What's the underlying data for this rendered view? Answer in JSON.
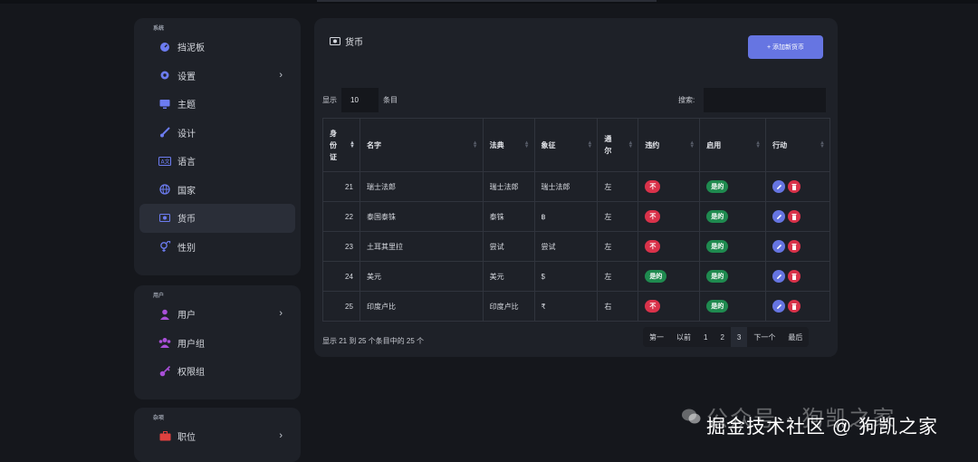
{
  "sidebar": {
    "section_system": "系统",
    "system_items": [
      {
        "label": "挡泥板",
        "icon": "dashboard-icon",
        "chevron": false,
        "active": false
      },
      {
        "label": "设置",
        "icon": "gear-icon",
        "chevron": true,
        "active": false
      },
      {
        "label": "主题",
        "icon": "monitor-icon",
        "chevron": false,
        "active": false
      },
      {
        "label": "设计",
        "icon": "brush-icon",
        "chevron": false,
        "active": false
      },
      {
        "label": "语言",
        "icon": "language-icon",
        "chevron": false,
        "active": false
      },
      {
        "label": "国家",
        "icon": "globe-icon",
        "chevron": false,
        "active": false
      },
      {
        "label": "货币",
        "icon": "money-icon",
        "chevron": false,
        "active": true
      },
      {
        "label": "性别",
        "icon": "gender-icon",
        "chevron": false,
        "active": false
      }
    ],
    "section_users": "用户",
    "user_items": [
      {
        "label": "用户",
        "icon": "user-icon",
        "chevron": true
      },
      {
        "label": "用户组",
        "icon": "users-icon",
        "chevron": false
      },
      {
        "label": "权限组",
        "icon": "key-icon",
        "chevron": false
      }
    ],
    "section_misc": "杂项",
    "misc_items": [
      {
        "label": "职位",
        "icon": "briefcase-icon",
        "chevron": true
      }
    ]
  },
  "main": {
    "title": "货币",
    "add_button": "+ 添加新货币",
    "show_label": "显示",
    "page_length": "10",
    "entries_label": "条目",
    "search_label": "搜索:",
    "columns": [
      "身份证",
      "名字",
      "法典",
      "象征",
      "通尔",
      "违约",
      "启用",
      "行动"
    ],
    "rows": [
      {
        "id": "21",
        "name": "瑞士法郎",
        "code": "瑞士法郎",
        "symbol": "瑞士法郎",
        "dir": "左",
        "default": "不",
        "enabled": "是的"
      },
      {
        "id": "22",
        "name": "泰国泰铢",
        "code": "泰铢",
        "symbol": "฿",
        "dir": "左",
        "default": "不",
        "enabled": "是的"
      },
      {
        "id": "23",
        "name": "土耳其里拉",
        "code": "尝试",
        "symbol": "尝试",
        "dir": "左",
        "default": "不",
        "enabled": "是的"
      },
      {
        "id": "24",
        "name": "美元",
        "code": "美元",
        "symbol": "$",
        "dir": "左",
        "default": "是的",
        "enabled": "是的"
      },
      {
        "id": "25",
        "name": "印度卢比",
        "code": "印度卢比",
        "symbol": "₹",
        "dir": "右",
        "default": "不",
        "enabled": "是的"
      }
    ],
    "info_text": "显示 21 到 25 个条目中的 25 个",
    "pager": [
      "第一",
      "以前",
      "1",
      "2",
      "3",
      "下一个",
      "最后"
    ],
    "pager_current": "3"
  },
  "watermark": {
    "line1": "公众号 · 狗凯之家",
    "line2": "掘金技术社区 @ 狗凯之家"
  },
  "colors": {
    "accent": "#6675e2",
    "danger": "#d9324a",
    "success": "#1f8a4f",
    "card": "#1e2128",
    "bg": "#15171c"
  }
}
